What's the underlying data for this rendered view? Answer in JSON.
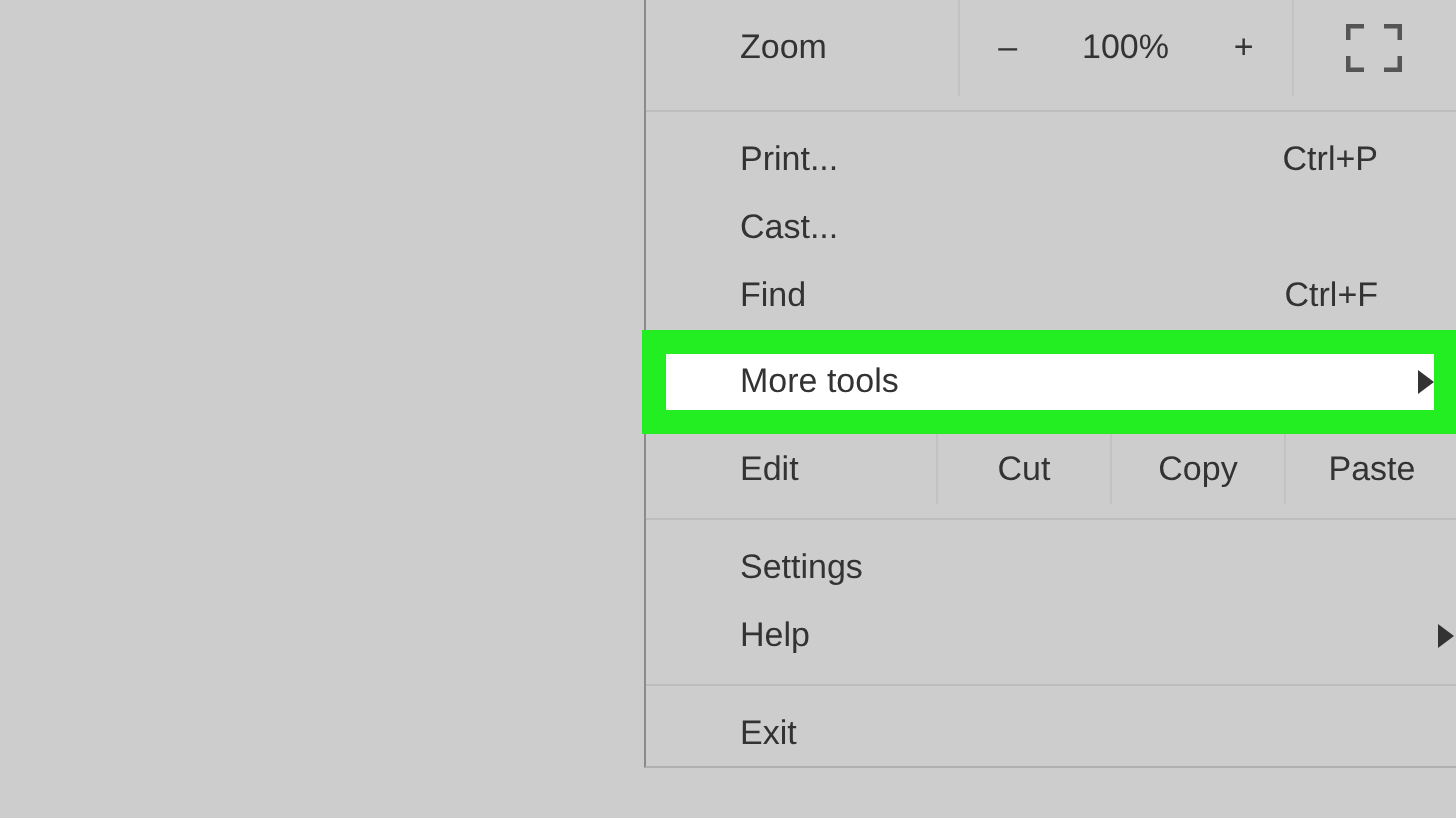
{
  "menu": {
    "zoom": {
      "label": "Zoom",
      "minus": "–",
      "value": "100%",
      "plus": "+"
    },
    "entries": [
      {
        "kind": "separator"
      },
      {
        "kind": "item",
        "label": "Print...",
        "shortcut": "Ctrl+P",
        "submenu": false,
        "selected": false
      },
      {
        "kind": "item",
        "label": "Cast...",
        "submenu": false,
        "selected": false
      },
      {
        "kind": "item",
        "label": "Find",
        "shortcut": "Ctrl+F",
        "submenu": false,
        "selected": false
      },
      {
        "kind": "item",
        "label": "More tools",
        "submenu": true,
        "selected": true
      },
      {
        "kind": "edit",
        "label": "Edit",
        "actions": [
          "Cut",
          "Copy",
          "Paste"
        ]
      },
      {
        "kind": "separator"
      },
      {
        "kind": "item",
        "label": "Settings",
        "submenu": false,
        "selected": false
      },
      {
        "kind": "item",
        "label": "Help",
        "submenu": true,
        "selected": false
      },
      {
        "kind": "separator"
      },
      {
        "kind": "item",
        "label": "Exit",
        "submenu": false,
        "selected": false
      }
    ]
  }
}
